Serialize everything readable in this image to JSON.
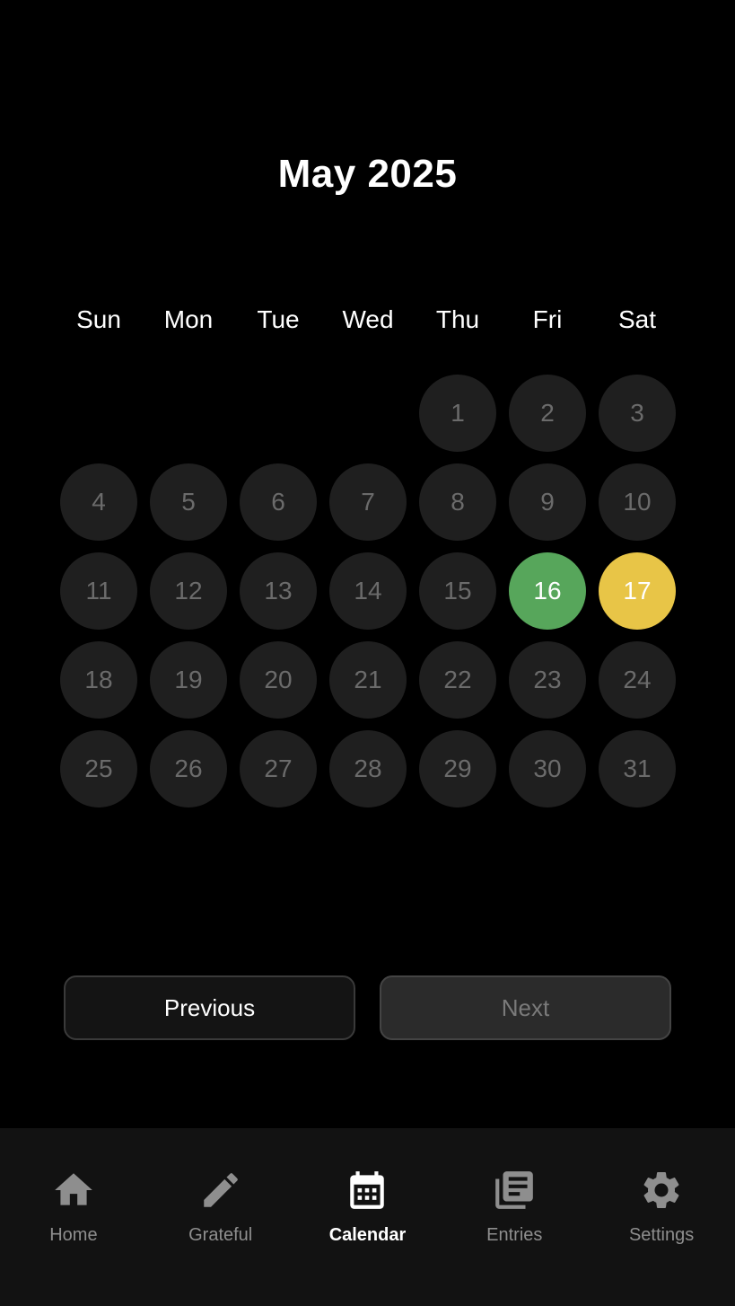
{
  "header": {
    "month_title": "May 2025"
  },
  "weekdays": [
    "Sun",
    "Mon",
    "Tue",
    "Wed",
    "Thu",
    "Fri",
    "Sat"
  ],
  "calendar": {
    "first_weekday_index": 4,
    "days": [
      {
        "day": "1",
        "state": "default"
      },
      {
        "day": "2",
        "state": "default"
      },
      {
        "day": "3",
        "state": "default"
      },
      {
        "day": "4",
        "state": "default"
      },
      {
        "day": "5",
        "state": "default"
      },
      {
        "day": "6",
        "state": "default"
      },
      {
        "day": "7",
        "state": "default"
      },
      {
        "day": "8",
        "state": "default"
      },
      {
        "day": "9",
        "state": "default"
      },
      {
        "day": "10",
        "state": "default"
      },
      {
        "day": "11",
        "state": "default"
      },
      {
        "day": "12",
        "state": "default"
      },
      {
        "day": "13",
        "state": "default"
      },
      {
        "day": "14",
        "state": "default"
      },
      {
        "day": "15",
        "state": "default"
      },
      {
        "day": "16",
        "state": "green"
      },
      {
        "day": "17",
        "state": "yellow"
      },
      {
        "day": "18",
        "state": "default"
      },
      {
        "day": "19",
        "state": "default"
      },
      {
        "day": "20",
        "state": "default"
      },
      {
        "day": "21",
        "state": "default"
      },
      {
        "day": "22",
        "state": "default"
      },
      {
        "day": "23",
        "state": "default"
      },
      {
        "day": "24",
        "state": "default"
      },
      {
        "day": "25",
        "state": "default"
      },
      {
        "day": "26",
        "state": "default"
      },
      {
        "day": "27",
        "state": "default"
      },
      {
        "day": "28",
        "state": "default"
      },
      {
        "day": "29",
        "state": "default"
      },
      {
        "day": "30",
        "state": "default"
      },
      {
        "day": "31",
        "state": "default"
      }
    ]
  },
  "navigation": {
    "previous_label": "Previous",
    "next_label": "Next"
  },
  "tabbar": {
    "items": [
      {
        "label": "Home",
        "icon": "home-icon",
        "active": false
      },
      {
        "label": "Grateful",
        "icon": "pencil-icon",
        "active": false
      },
      {
        "label": "Calendar",
        "icon": "calendar-icon",
        "active": true
      },
      {
        "label": "Entries",
        "icon": "library-books-icon",
        "active": false
      },
      {
        "label": "Settings",
        "icon": "gear-icon",
        "active": false
      }
    ]
  },
  "colors": {
    "background": "#000000",
    "day_circle": "#1f1f1f",
    "day_text": "#6b6b6b",
    "green": "#57a65b",
    "yellow": "#e8c547",
    "tabbar_bg": "#121212",
    "tab_inactive": "#8e8e8e",
    "tab_active": "#ffffff"
  }
}
